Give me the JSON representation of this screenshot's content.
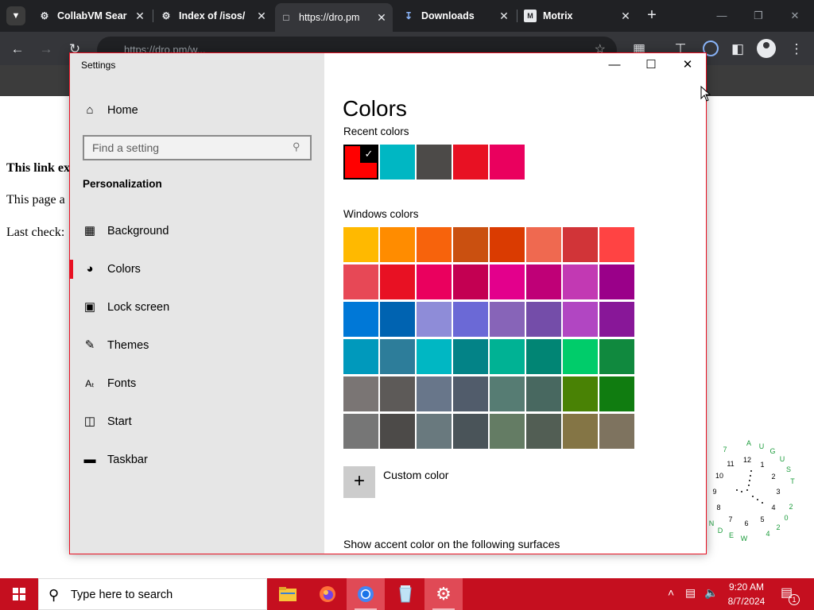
{
  "browser": {
    "tabs": [
      {
        "label": "CollabVM Sear",
        "icon": "collabvm-icon"
      },
      {
        "label": "Index of /isos/",
        "icon": "collabvm-icon"
      },
      {
        "label": "https://dro.pm",
        "icon": "folder-icon"
      },
      {
        "label": "Downloads",
        "icon": "download-icon"
      },
      {
        "label": "Motrix",
        "icon": "motrix-icon"
      }
    ],
    "address": "https://dro.pm/w..."
  },
  "page": {
    "line1": "This link ex",
    "line2": "This page a",
    "line3": "Last check:"
  },
  "settings": {
    "window_title": "Settings",
    "home_label": "Home",
    "search_placeholder": "Find a setting",
    "section_title": "Personalization",
    "nav": [
      {
        "label": "Background",
        "icon": "picture-icon",
        "selected": false
      },
      {
        "label": "Colors",
        "icon": "palette-icon",
        "selected": true
      },
      {
        "label": "Lock screen",
        "icon": "lock-screen-icon",
        "selected": false
      },
      {
        "label": "Themes",
        "icon": "themes-brush-icon",
        "selected": false
      },
      {
        "label": "Fonts",
        "icon": "fonts-icon",
        "selected": false
      },
      {
        "label": "Start",
        "icon": "start-grid-icon",
        "selected": false
      },
      {
        "label": "Taskbar",
        "icon": "taskbar-icon",
        "selected": false
      }
    ],
    "page_title": "Colors",
    "recent_colors_label": "Recent colors",
    "recent_colors": [
      "#ff0000",
      "#00b7c3",
      "#4c4a48",
      "#e81123",
      "#ea005e"
    ],
    "recent_selected_index": 0,
    "windows_colors_label": "Windows colors",
    "windows_colors": [
      [
        "#ffb900",
        "#ff8c00",
        "#f7630c",
        "#ca5010",
        "#da3b01",
        "#ef6950",
        "#d13438",
        "#ff4343"
      ],
      [
        "#e74856",
        "#e81123",
        "#ea005e",
        "#c30052",
        "#e3008c",
        "#bf0077",
        "#c239b3",
        "#9a0089"
      ],
      [
        "#0078d7",
        "#0063b1",
        "#8e8cd8",
        "#6b69d6",
        "#8764b8",
        "#744da9",
        "#b146c2",
        "#881798"
      ],
      [
        "#0099bc",
        "#2d7d9a",
        "#00b7c3",
        "#038387",
        "#00b294",
        "#018574",
        "#00cc6a",
        "#10893e"
      ],
      [
        "#7a7574",
        "#5d5a58",
        "#68768a",
        "#515c6b",
        "#567c73",
        "#486860",
        "#498205",
        "#107c10"
      ],
      [
        "#767676",
        "#4c4a48",
        "#69797e",
        "#4a5459",
        "#647c64",
        "#525e54",
        "#847545",
        "#7e735f"
      ]
    ],
    "custom_color_label": "Custom color",
    "surfaces_label": "Show accent color on the following surfaces",
    "accent_color": "#e81123"
  },
  "clock_widget": {
    "month": [
      "A",
      "U",
      "G",
      "U",
      "S",
      "T"
    ],
    "weekday": [
      "W",
      "E",
      "D",
      "N"
    ],
    "day": [
      "7"
    ],
    "hours": [
      "12",
      "1",
      "2",
      "3",
      "4",
      "5",
      "6",
      "7",
      "8",
      "9",
      "10",
      "11"
    ],
    "year": [
      "2",
      "0",
      "2",
      "4"
    ]
  },
  "taskbar": {
    "search_text": "Type here to search",
    "time": "9:20 AM",
    "date": "8/7/2024",
    "notification_count": "1",
    "color": "#c50f1f"
  }
}
